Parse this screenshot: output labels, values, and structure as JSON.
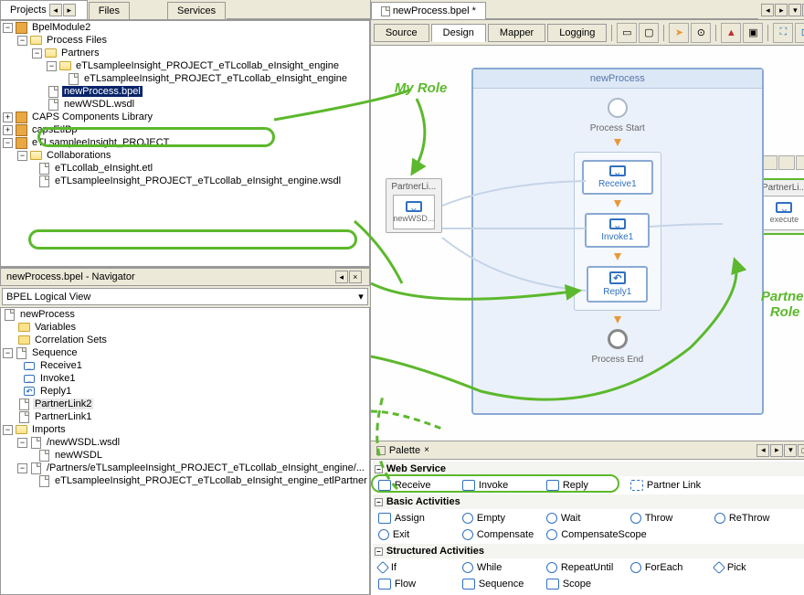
{
  "left_tabs": {
    "projects": "Projects",
    "files": "Files",
    "services": "Services"
  },
  "tree": {
    "root0": "BpelModule2",
    "processFiles": "Process Files",
    "partners": "Partners",
    "partner0": "eTLsampleeInsight_PROJECT_eTLcollab_eInsight_engine",
    "partner0file": "eTLsampleeInsight_PROJECT_eTLcollab_eInsight_engine",
    "bpel": "newProcess.bpel",
    "wsdl": "newWSDL.wsdl",
    "caps_lib": "CAPS Components Library",
    "caps_bp": "capsEtlBp",
    "proj": "eTLsampleeInsight_PROJECT",
    "collab": "Collaborations",
    "etl": "eTLcollab_eInsight.etl",
    "engine_wsdl": "eTLsampleeInsight_PROJECT_eTLcollab_eInsight_engine.wsdl"
  },
  "navigator": {
    "title": "newProcess.bpel - Navigator",
    "view": "BPEL Logical View",
    "items": {
      "proc": "newProcess",
      "vars": "Variables",
      "corr": "Correlation Sets",
      "seq": "Sequence",
      "recv": "Receive1",
      "inv": "Invoke1",
      "rep": "Reply1",
      "pl2": "PartnerLink2",
      "pl1": "PartnerLink1",
      "imp": "Imports",
      "w1": "/newWSDL.wsdl",
      "w1f": "newWSDL",
      "w2": "/Partners/eTLsampleeInsight_PROJECT_eTLcollab_eInsight_engine/...",
      "w2f": "eTLsampleeInsight_PROJECT_eTLcollab_eInsight_engine_etlPartner"
    }
  },
  "editor": {
    "tab": "newProcess.bpel *",
    "views": {
      "source": "Source",
      "design": "Design",
      "mapper": "Mapper",
      "logging": "Logging"
    },
    "process_title": "newProcess",
    "start": "Process Start",
    "end": "Process End",
    "recv": "Receive1",
    "inv": "Invoke1",
    "rep": "Reply1",
    "pl_left": "PartnerLi...",
    "pl_left_sub": "newWSD...",
    "pl_right": "PartnerLi...",
    "pl_right_sub": "execute"
  },
  "annotations": {
    "myrole": "My Role",
    "partnerrole": "Partner\nRole"
  },
  "palette": {
    "title": "Palette",
    "groups": {
      "ws": "Web Service",
      "ba": "Basic Activities",
      "sa": "Structured Activities"
    },
    "ws_items": {
      "receive": "Receive",
      "invoke": "Invoke",
      "reply": "Reply",
      "partner": "Partner Link"
    },
    "ba_items": {
      "assign": "Assign",
      "empty": "Empty",
      "wait": "Wait",
      "throw": "Throw",
      "rethrow": "ReThrow",
      "exit": "Exit",
      "compensate": "Compensate",
      "compscope": "CompensateScope"
    },
    "sa_items": {
      "if": "If",
      "while": "While",
      "repeat": "RepeatUntil",
      "foreach": "ForEach",
      "pick": "Pick",
      "flow": "Flow",
      "sequence": "Sequence",
      "scope": "Scope"
    }
  }
}
